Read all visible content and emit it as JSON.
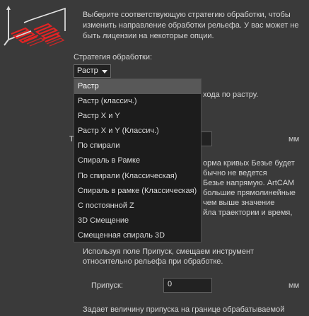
{
  "intro": {
    "line1": "Выберите соответствующую стратегию обработки, чтобы",
    "line2": "изменить направление обработки рельефа. У вас может не",
    "line3": "быть лицензии на некоторые опции."
  },
  "strategy": {
    "label": "Стратегия обработки:",
    "selected": "Растр",
    "options": [
      "Растр",
      "Растр (классич.)",
      "Растр X и Y",
      "Растр X и Y (Классич.)",
      "По спирали",
      "Спираль в Рамке",
      "По спирали (Классическая)",
      "Спираль в рамке (Классическая)",
      "С постоянной Z",
      "3D Смещение",
      "Смещенная спираль 3D"
    ]
  },
  "hidden_fragments": {
    "raster_tail": "хода по растру.",
    "t_letter": "Т",
    "unit1": "мм",
    "bezier1": "орма кривых Безье будет",
    "bezier2": "бычно не ведется",
    "bezier3": "Безье напрямую. ArtCAM",
    "bezier4": "большие прямолинейные",
    "bezier5": "чем выше значение",
    "bezier6": "йла траектории и время,"
  },
  "allowance": {
    "desc1": "Используя поле Припуск, смещаем инструмент",
    "desc2": "относительно рельефа при обработке.",
    "label": "Припуск:",
    "value": "0",
    "unit": "мм"
  },
  "bottom": {
    "text": "Задает величину припуска на границе обрабатываемой"
  },
  "colors": {
    "accent_red": "#e02424",
    "panel": "#3a3a3a"
  }
}
